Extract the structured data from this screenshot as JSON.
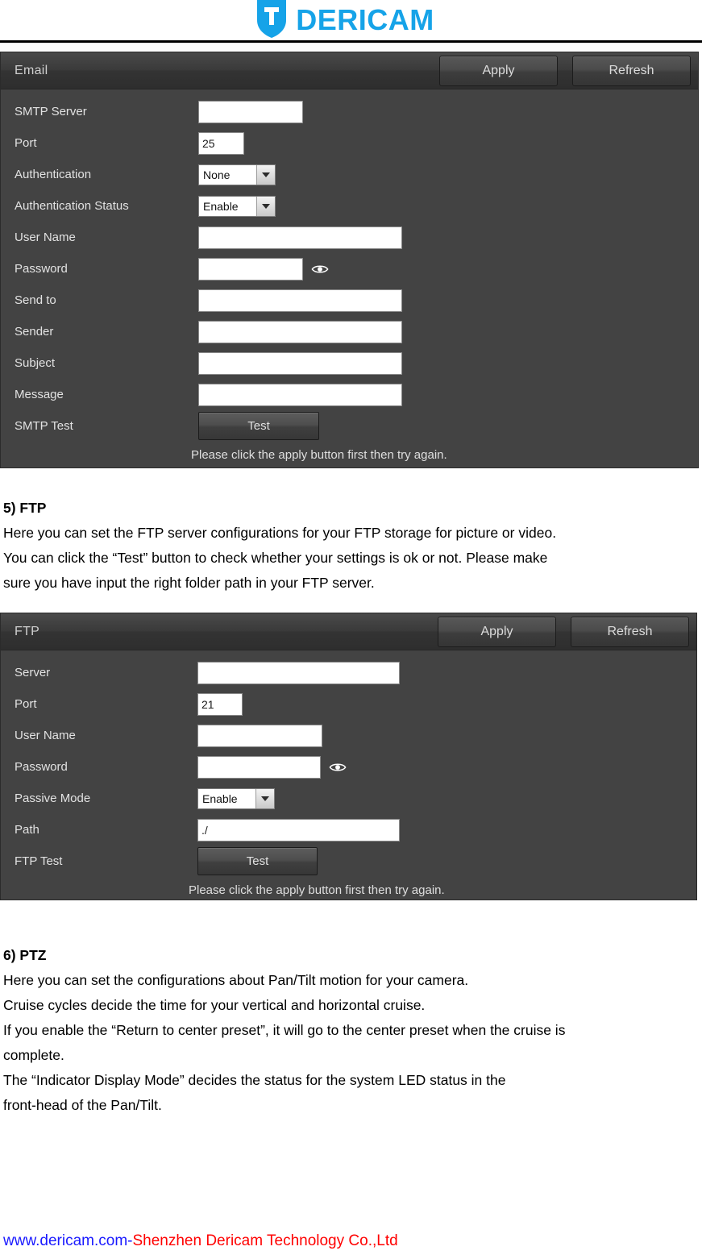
{
  "header": {
    "logo_text": "DERICAM",
    "logo_color": "#16a3e8",
    "logo_icon": "dericam-shield-logo"
  },
  "email_panel": {
    "title": "Email",
    "apply_label": "Apply",
    "refresh_label": "Refresh",
    "note": "Please click the apply button first then try again.",
    "fields": [
      {
        "label": "SMTP Server",
        "type": "text",
        "value": ""
      },
      {
        "label": "Port",
        "type": "text",
        "value": "25"
      },
      {
        "label": "Authentication",
        "type": "select",
        "value": "None"
      },
      {
        "label": "Authentication Status",
        "type": "select",
        "value": "Enable"
      },
      {
        "label": "User Name",
        "type": "text",
        "value": ""
      },
      {
        "label": "Password",
        "type": "password",
        "value": ""
      },
      {
        "label": "Send to",
        "type": "text",
        "value": ""
      },
      {
        "label": "Sender",
        "type": "text",
        "value": ""
      },
      {
        "label": "Subject",
        "type": "text",
        "value": ""
      },
      {
        "label": "Message",
        "type": "text",
        "value": ""
      },
      {
        "label": "SMTP Test",
        "type": "button",
        "value": "Test"
      }
    ]
  },
  "section_ftp": {
    "heading": "5) FTP",
    "lines": [
      "Here you can set the FTP server configurations for your FTP storage for picture or video.",
      "You can click the “Test” button to check whether your settings is ok or not. Please make",
      "sure you have input the right folder path in your FTP server."
    ]
  },
  "ftp_panel": {
    "title": "FTP",
    "apply_label": "Apply",
    "refresh_label": "Refresh",
    "note": "Please click the apply button first then try again.",
    "fields": [
      {
        "label": "Server",
        "type": "text",
        "value": ""
      },
      {
        "label": "Port",
        "type": "text",
        "value": "21"
      },
      {
        "label": "User Name",
        "type": "text",
        "value": ""
      },
      {
        "label": "Password",
        "type": "password",
        "value": ""
      },
      {
        "label": "Passive Mode",
        "type": "select",
        "value": "Enable"
      },
      {
        "label": "Path",
        "type": "text",
        "value": "./"
      },
      {
        "label": "FTP Test",
        "type": "button",
        "value": "Test"
      }
    ]
  },
  "section_ptz": {
    "heading": "6) PTZ",
    "lines": [
      "Here you can set the configurations about Pan/Tilt motion for your camera.",
      "Cruise cycles decide the time for your vertical and horizontal cruise.",
      "If you enable the “Return to center preset”, it will go to the center preset when the cruise is",
      "complete.",
      "The “Indicator Display Mode” decides the status for the system LED status in the",
      "front-head of the Pan/Tilt."
    ]
  },
  "footer": {
    "site": "www.dericam.com-",
    "company": "Shenzhen Dericam Technology Co.,Ltd"
  }
}
